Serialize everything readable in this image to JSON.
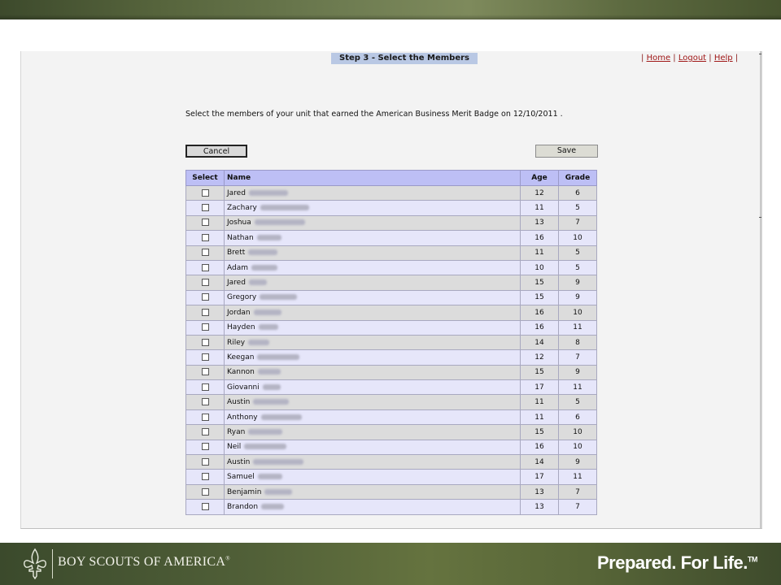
{
  "header": {
    "step_title": "Step 3 - Select the Members",
    "links": {
      "home": "Home",
      "logout": "Logout",
      "help": "Help",
      "sep": "|"
    }
  },
  "instruction": "Select the members of your unit that earned the American Business Merit Badge on 12/10/2011 .",
  "buttons": {
    "cancel": "Cancel",
    "save": "Save"
  },
  "table": {
    "columns": [
      "Select",
      "Name",
      "Age",
      "Grade"
    ],
    "rows": [
      {
        "name": "Jared",
        "age": "12",
        "grade": "6"
      },
      {
        "name": "Zachary",
        "age": "11",
        "grade": "5"
      },
      {
        "name": "Joshua",
        "age": "13",
        "grade": "7"
      },
      {
        "name": "Nathan",
        "age": "16",
        "grade": "10"
      },
      {
        "name": "Brett",
        "age": "11",
        "grade": "5"
      },
      {
        "name": "Adam",
        "age": "10",
        "grade": "5"
      },
      {
        "name": "Jared",
        "age": "15",
        "grade": "9"
      },
      {
        "name": "Gregory",
        "age": "15",
        "grade": "9"
      },
      {
        "name": "Jordan",
        "age": "16",
        "grade": "10"
      },
      {
        "name": "Hayden",
        "age": "16",
        "grade": "11"
      },
      {
        "name": "Riley",
        "age": "14",
        "grade": "8"
      },
      {
        "name": "Keegan",
        "age": "12",
        "grade": "7"
      },
      {
        "name": "Kannon",
        "age": "15",
        "grade": "9"
      },
      {
        "name": "Giovanni",
        "age": "17",
        "grade": "11"
      },
      {
        "name": "Austin",
        "age": "11",
        "grade": "5"
      },
      {
        "name": "Anthony",
        "age": "11",
        "grade": "6"
      },
      {
        "name": "Ryan",
        "age": "15",
        "grade": "10"
      },
      {
        "name": "Neil",
        "age": "16",
        "grade": "10"
      },
      {
        "name": "Austin",
        "age": "14",
        "grade": "9"
      },
      {
        "name": "Samuel",
        "age": "17",
        "grade": "11"
      },
      {
        "name": "Benjamin",
        "age": "13",
        "grade": "7"
      },
      {
        "name": "Brandon",
        "age": "13",
        "grade": "7"
      }
    ]
  },
  "footer": {
    "org_name": "BOY SCOUTS OF AMERICA",
    "org_mark": "®",
    "tagline": "Prepared. For Life.",
    "tagline_mark": "TM"
  },
  "colors": {
    "header_row": "#bdbff5",
    "row_odd": "#dcdcdc",
    "row_even": "#e6e6fa",
    "link": "#a01818",
    "step_title_bg": "#b9c8e4"
  },
  "icons": [
    "fleur-de-lis-icon",
    "checkbox-icon"
  ]
}
